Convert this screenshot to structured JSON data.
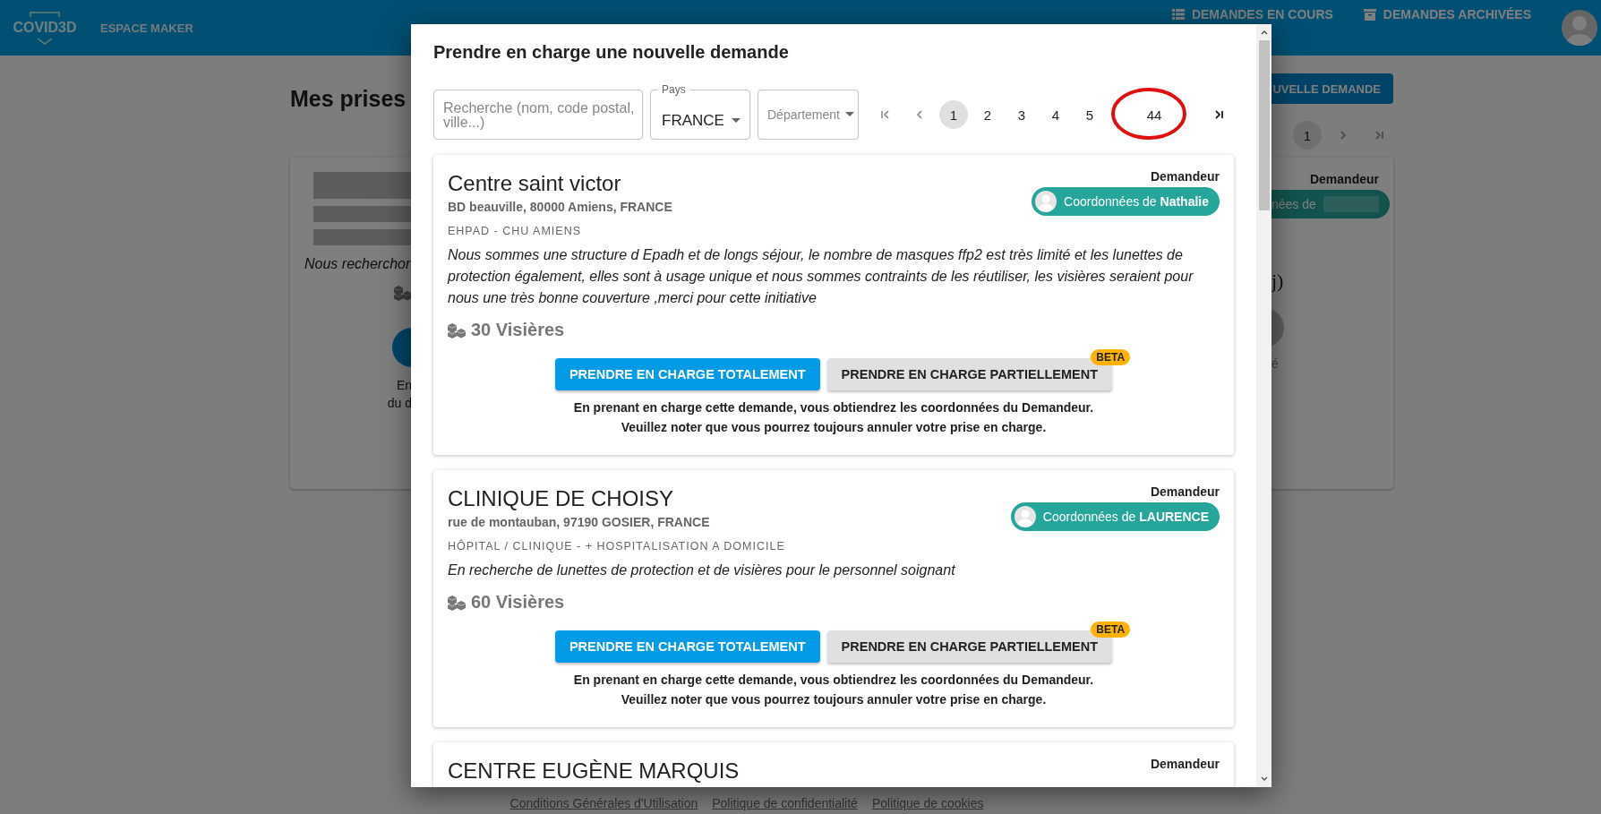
{
  "header": {
    "logo": "COVID3D",
    "section": "ESPACE MAKER",
    "nav": [
      {
        "label": "DEMANDES EN COURS"
      },
      {
        "label": "DEMANDES ARCHIVÉES"
      }
    ]
  },
  "page": {
    "title": "Mes prises",
    "new_request_button": "UVELLE DEMANDE",
    "pagination": [
      {
        "label": "1",
        "selected": true
      }
    ],
    "card": {
      "description": "Nous recherchon",
      "lines": [
        "En",
        "du d"
      ],
      "requester_label": "Demandeur",
      "contact": "nées de",
      "unit": "j)",
      "note": "é"
    }
  },
  "footer_links": [
    "Conditions Générales d'Utilisation",
    "Politique de confidentialité",
    "Politique de cookies"
  ],
  "modal": {
    "title": "Prendre en charge une nouvelle demande",
    "search": {
      "placeholder": "Recherche (nom, code postal, ville...)"
    },
    "country": {
      "label": "Pays",
      "value": "FRANCE"
    },
    "department": {
      "placeholder": "Département"
    },
    "pagination": [
      {
        "label": "1",
        "selected": true
      },
      {
        "label": "2",
        "selected": false
      },
      {
        "label": "3",
        "selected": false
      },
      {
        "label": "4",
        "selected": false
      },
      {
        "label": "5",
        "selected": false
      },
      {
        "label": "44",
        "selected": false
      }
    ],
    "requests": [
      {
        "name": "Centre saint victor",
        "address": "BD beauville, 80000 Amiens, FRANCE",
        "category": "EHPAD - CHU AMIENS",
        "description": "Nous sommes une structure d Epadh et de longs séjour, le nombre de masques ffp2 est très limité et les lunettes de protection également, elles sont à usage unique et nous sommes contraints de les réutiliser, les visières seraient pour nous une très bonne couverture ,merci pour cette initiative",
        "quantity": "30 Visières",
        "requester_label": "Demandeur",
        "contact": "Coordonnées de **Nathalie**",
        "full_button": "PRENDRE EN CHARGE TOTALEMENT",
        "partial_button": "PRENDRE EN CHARGE PARTIELLEMENT",
        "partial_badge": "BETA",
        "notes": [
          "En prenant en charge cette demande, vous obtiendrez les coordonnées du Demandeur.",
          "Veuillez noter que vous pourrez toujours annuler votre prise en charge."
        ]
      },
      {
        "name": "CLINIQUE DE CHOISY",
        "address": "rue de montauban, 97190 GOSIER, FRANCE",
        "category": "HÔPITAL / CLINIQUE - + HOSPITALISATION A DOMICILE",
        "description": "En recherche de lunettes de protection et de visières pour le personnel soignant",
        "quantity": "60 Visières",
        "requester_label": "Demandeur",
        "contact": "Coordonnées de **LAURENCE**",
        "full_button": "PRENDRE EN CHARGE TOTALEMENT",
        "partial_button": "PRENDRE EN CHARGE PARTIELLEMENT",
        "partial_badge": "BETA",
        "notes": [
          "En prenant en charge cette demande, vous obtiendrez les coordonnées du Demandeur.",
          "Veuillez noter que vous pourrez toujours annuler votre prise en charge."
        ]
      },
      {
        "name": "CENTRE EUGÈNE MARQUIS",
        "requester_label": "Demandeur"
      }
    ]
  }
}
